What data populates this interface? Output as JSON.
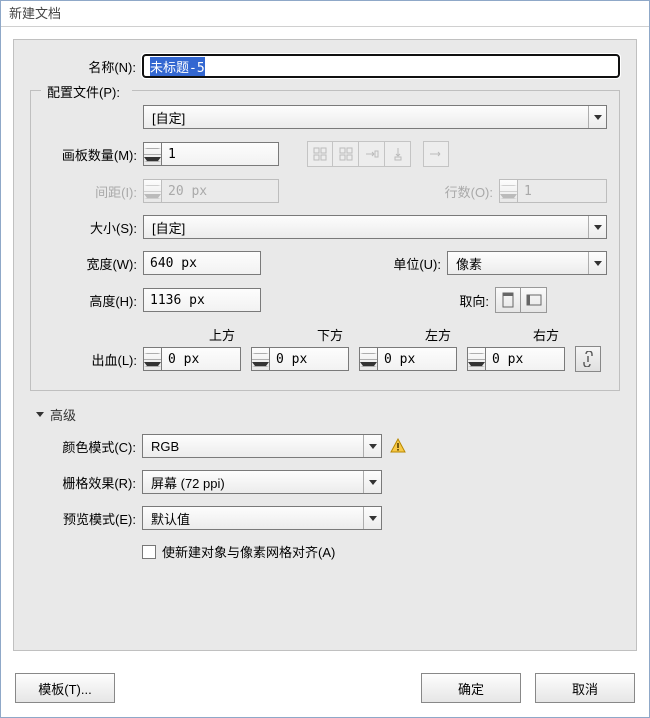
{
  "window_title": "新建文档",
  "name": {
    "label": "名称(N):",
    "value": "未标题-5"
  },
  "profile": {
    "label": "配置文件(P):",
    "value": "[自定]"
  },
  "artboards": {
    "label": "画板数量(M):",
    "value": "1"
  },
  "spacing": {
    "label": "间距(I):",
    "value": "20 px"
  },
  "rows": {
    "label": "行数(O):",
    "value": "1"
  },
  "size": {
    "label": "大小(S):",
    "value": "[自定]"
  },
  "width": {
    "label": "宽度(W):",
    "value": "640 px"
  },
  "units": {
    "label": "单位(U):",
    "value": "像素"
  },
  "height": {
    "label": "高度(H):",
    "value": "1136 px"
  },
  "orientation": {
    "label": "取向:"
  },
  "bleed": {
    "label": "出血(L):",
    "top_label": "上方",
    "top": "0 px",
    "bottom_label": "下方",
    "bottom": "0 px",
    "left_label": "左方",
    "left": "0 px",
    "right_label": "右方",
    "right": "0 px"
  },
  "advanced": {
    "title": "高级",
    "color_mode": {
      "label": "颜色模式(C):",
      "value": "RGB"
    },
    "raster": {
      "label": "栅格效果(R):",
      "value": "屏幕 (72 ppi)"
    },
    "preview": {
      "label": "预览模式(E):",
      "value": "默认值"
    },
    "align_checkbox": "使新建对象与像素网格对齐(A)"
  },
  "buttons": {
    "templates": "模板(T)...",
    "ok": "确定",
    "cancel": "取消"
  }
}
